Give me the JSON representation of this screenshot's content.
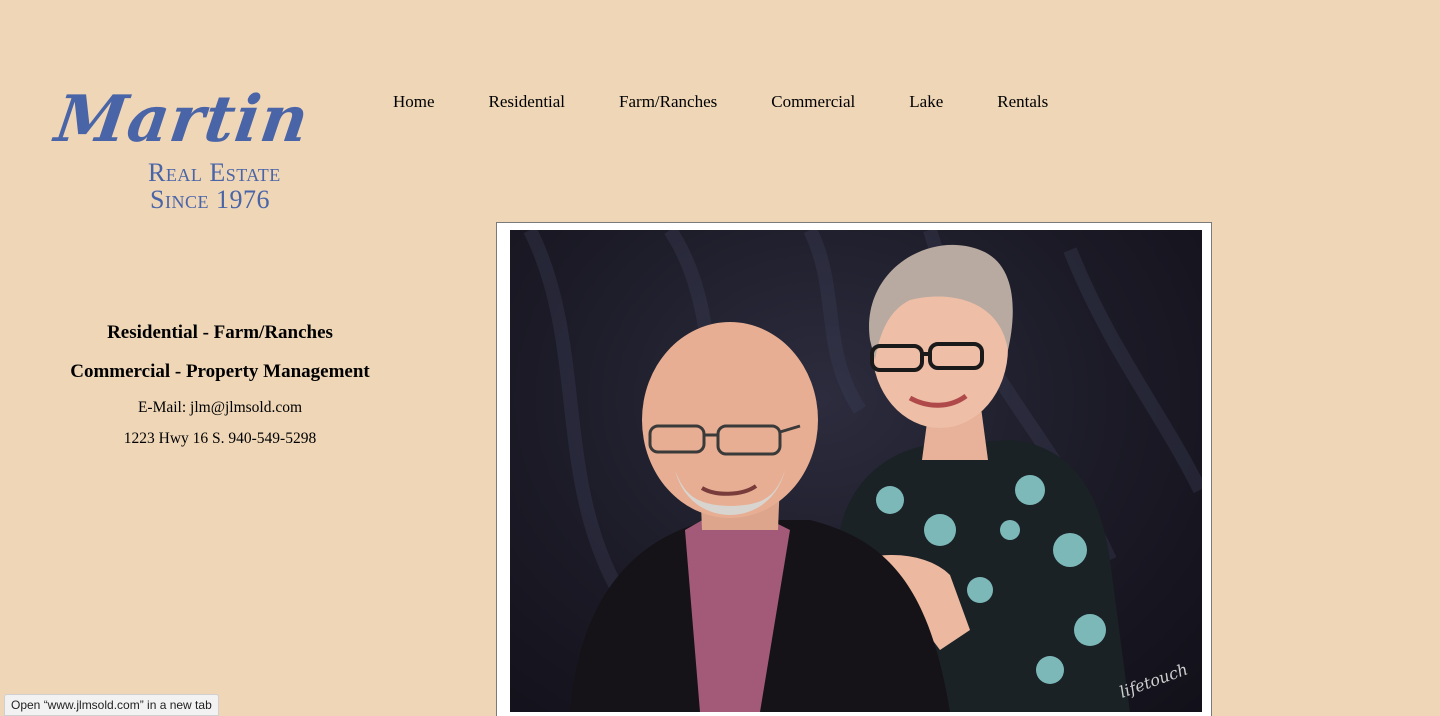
{
  "logo": {
    "script": "Martin",
    "line1": "Real Estate",
    "line2": "Since 1976",
    "color": "#4a64a8"
  },
  "nav": {
    "items": [
      "Home",
      "Residential",
      "Farm/Ranches",
      "Commercial",
      "Lake",
      "Rentals"
    ]
  },
  "info": {
    "tagline1": "Residential - Farm/Ranches",
    "tagline2": "Commercial - Property Management",
    "email": "E-Mail: jlm@jlmsold.com",
    "address": "1223 Hwy 16 S. 940-549-5298"
  },
  "photo": {
    "signature": "lifetouch"
  },
  "status": {
    "text": "Open “www.jlmsold.com” in a new tab"
  },
  "colors": {
    "background": "#eed6b7",
    "logo": "#4a64a8"
  }
}
